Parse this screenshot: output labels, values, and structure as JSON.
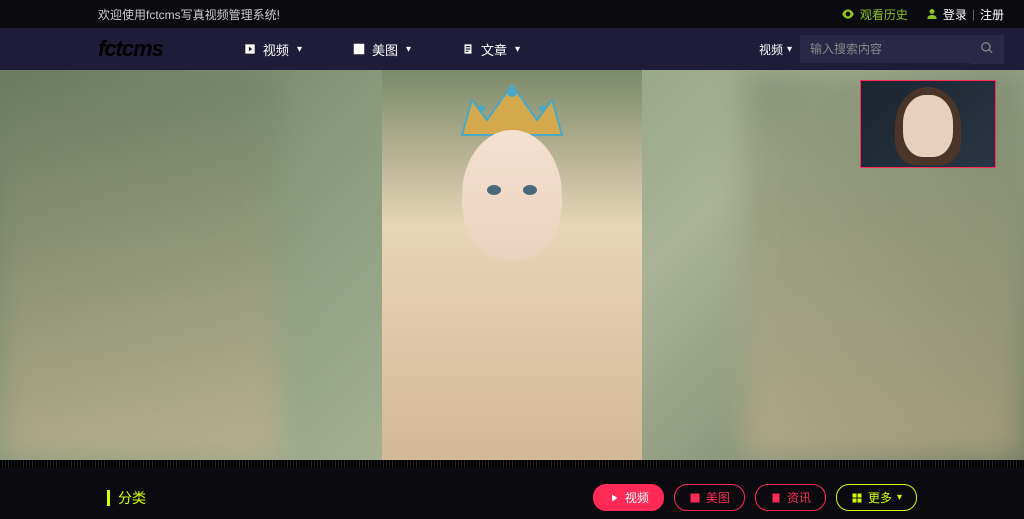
{
  "topbar": {
    "welcome": "欢迎使用fctcms写真视频管理系统!",
    "history": "观看历史",
    "login": "登录",
    "sep": "|",
    "register": "注册"
  },
  "nav": {
    "logo": "fctcms",
    "items": [
      {
        "icon": "video",
        "label": "视频"
      },
      {
        "icon": "image",
        "label": "美图"
      },
      {
        "icon": "doc",
        "label": "文章"
      }
    ],
    "search": {
      "category": "视频",
      "placeholder": "输入搜索内容"
    }
  },
  "category": {
    "label": "分类",
    "pills": [
      {
        "style": "red",
        "icon": "video",
        "label": "视频"
      },
      {
        "style": "red-outline",
        "icon": "image",
        "label": "美图"
      },
      {
        "style": "red-outline",
        "icon": "doc",
        "label": "资讯"
      },
      {
        "style": "yellow",
        "icon": "grid",
        "label": "更多"
      }
    ]
  }
}
